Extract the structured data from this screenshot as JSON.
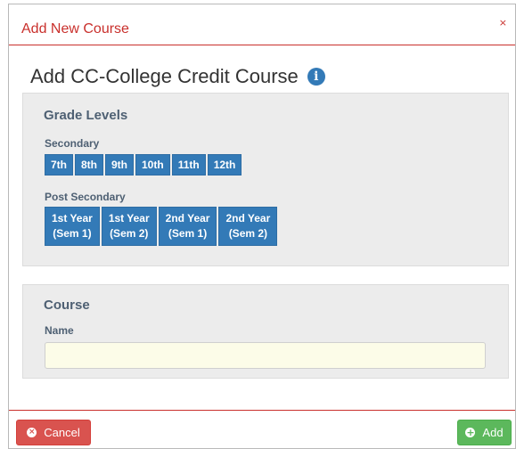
{
  "modal": {
    "title": "Add New Course",
    "close_symbol": "×",
    "heading": "Add CC-College Credit Course",
    "info_symbol": "i"
  },
  "grade_levels": {
    "title": "Grade Levels",
    "secondary_label": "Secondary",
    "secondary": [
      "7th",
      "8th",
      "9th",
      "10th",
      "11th",
      "12th"
    ],
    "post_secondary_label": "Post Secondary",
    "post_secondary": [
      {
        "line1": "1st Year",
        "line2": "(Sem 1)"
      },
      {
        "line1": "1st Year",
        "line2": "(Sem 2)"
      },
      {
        "line1": "2nd Year",
        "line2": "(Sem 1)"
      },
      {
        "line1": "2nd Year",
        "line2": "(Sem 2)"
      }
    ]
  },
  "course": {
    "title": "Course",
    "name_label": "Name",
    "name_value": "",
    "name_placeholder": ""
  },
  "footer": {
    "cancel_label": "Cancel",
    "cancel_symbol": "×",
    "add_label": "Add",
    "add_symbol": "+"
  },
  "colors": {
    "header_accent": "#c9302c",
    "primary": "#337ab7",
    "danger": "#d9534f",
    "success": "#5cb85c",
    "panel_bg": "#ececec",
    "panel_text": "#4e6073",
    "input_bg": "#fcfce8"
  },
  "icons": {
    "close": "close-icon",
    "info": "info-icon",
    "cancel": "times-circle-icon",
    "add": "plus-circle-icon"
  }
}
